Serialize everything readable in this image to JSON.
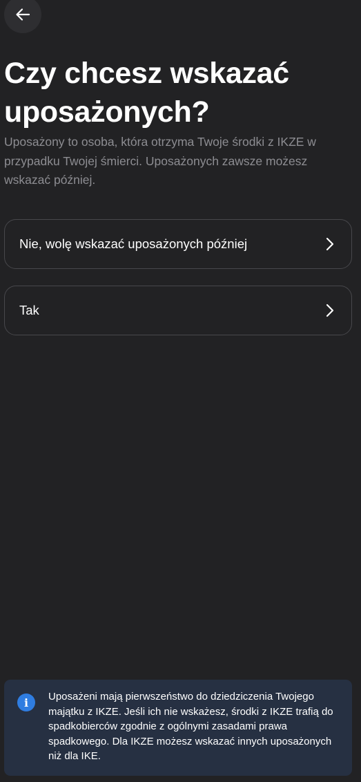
{
  "header": {
    "back_icon": "arrow-left-icon"
  },
  "main": {
    "title": "Czy chcesz wskazać uposażonych?",
    "subtitle": "Uposażony to osoba, która otrzyma Twoje środki z IKZE w przypadku Twojej śmierci. Uposażonych zawsze możesz wskazać później.",
    "options": [
      {
        "label": "Nie, wolę wskazać uposażonych później",
        "icon": "chevron-right-icon"
      },
      {
        "label": "Tak",
        "icon": "chevron-right-icon"
      }
    ]
  },
  "info": {
    "icon": "info-icon",
    "icon_glyph": "i",
    "text": "Uposażeni mają pierwszeństwo do dziedziczenia Twojego majątku z IKZE. Jeśli ich nie wskażesz, środki z IKZE trafią do spadkobierców zgodnie z ogólnymi zasadami prawa spadkowego. Dla IKZE możesz wskazać innych uposażonych niż dla IKE."
  },
  "colors": {
    "background": "#222224",
    "text_primary": "#ffffff",
    "text_secondary": "#8d8d92",
    "card_border": "#48484c",
    "info_background": "#263042",
    "info_accent": "#2f7de1"
  }
}
